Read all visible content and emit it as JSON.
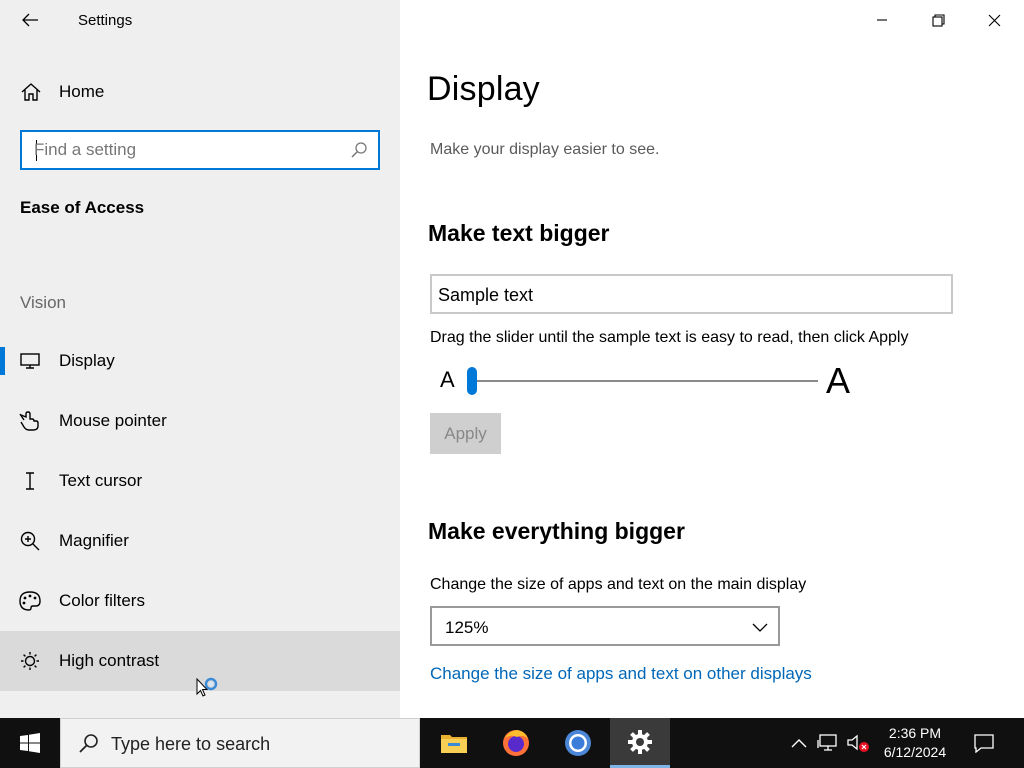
{
  "window": {
    "title": "Settings"
  },
  "sidebar": {
    "home_label": "Home",
    "search_placeholder": "Find a setting",
    "section_title": "Ease of Access",
    "group_label": "Vision",
    "items": [
      {
        "label": "Display",
        "icon": "monitor-icon",
        "selected": true
      },
      {
        "label": "Mouse pointer",
        "icon": "mouse-pointer-icon"
      },
      {
        "label": "Text cursor",
        "icon": "text-cursor-icon"
      },
      {
        "label": "Magnifier",
        "icon": "magnifier-icon"
      },
      {
        "label": "Color filters",
        "icon": "color-filters-icon"
      },
      {
        "label": "High contrast",
        "icon": "high-contrast-icon",
        "hovered": true
      }
    ]
  },
  "main": {
    "title": "Display",
    "subtitle": "Make your display easier to see.",
    "text_bigger": {
      "heading": "Make text bigger",
      "sample_text": "Sample text",
      "instruction": "Drag the slider until the sample text is easy to read, then click Apply",
      "slider_small_label": "A",
      "slider_large_label": "A",
      "slider_value_fraction": 0.0,
      "apply_label": "Apply"
    },
    "everything_bigger": {
      "heading": "Make everything bigger",
      "label": "Change the size of apps and text on the main display",
      "scale_value": "125%",
      "link_other_displays": "Change the size of apps and text on other displays"
    }
  },
  "taskbar": {
    "search_text": "Type here to search",
    "apps": [
      "file-explorer-icon",
      "firefox-icon",
      "chrome-icon",
      "settings-icon"
    ],
    "active_app": "settings-icon",
    "time": "2:36 PM",
    "date": "6/12/2024"
  },
  "colors": {
    "accent": "#0078d7",
    "link": "#0067b8",
    "sidebar_bg": "#efefef",
    "taskbar_bg": "#101010"
  }
}
